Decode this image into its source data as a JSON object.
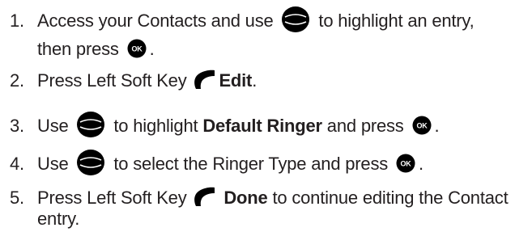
{
  "steps": [
    {
      "number": "1.",
      "line1_a": "Access your Contacts and use",
      "nav_icon": "navigation-key-icon",
      "line1_b": "to highlight an entry,",
      "line2_a": "then press",
      "ok_icon": "ok-key-icon",
      "line2_b": "."
    },
    {
      "number": "2.",
      "text_a": "Press Left Soft Key",
      "soft_icon": "left-soft-key-icon",
      "bold": "Edit",
      "text_b": "."
    },
    {
      "number": "3.",
      "text_a": "Use",
      "nav_icon": "navigation-key-icon",
      "text_b": "to highlight",
      "bold": "Default Ringer",
      "text_c": "and press",
      "ok_icon": "ok-key-icon",
      "text_d": "."
    },
    {
      "number": "4.",
      "text_a": "Use",
      "nav_icon": "navigation-key-icon",
      "text_b": "to select the Ringer Type and press",
      "ok_icon": "ok-key-icon",
      "text_c": "."
    },
    {
      "number": "5.",
      "text_a": "Press Left Soft Key",
      "soft_icon": "left-soft-key-icon",
      "bold": "Done",
      "text_b": "to continue editing the Contact",
      "line2": "entry."
    }
  ],
  "colors": {
    "text": "#231f20",
    "key": "#000000",
    "ok_label": "#ffffff"
  }
}
